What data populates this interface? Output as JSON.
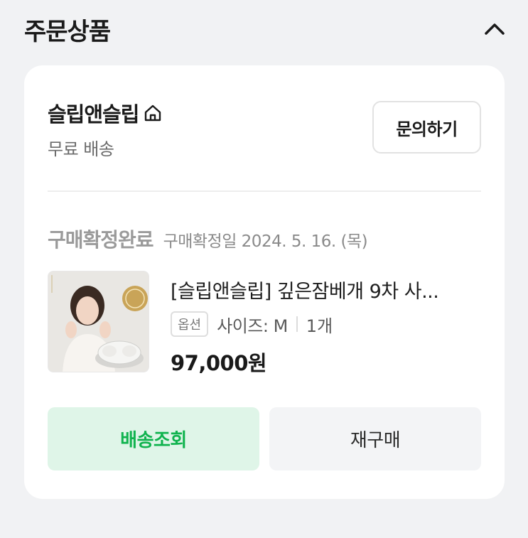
{
  "section": {
    "title": "주문상품",
    "collapse_icon": "chevron-up-icon"
  },
  "order": {
    "seller": {
      "name": "슬립앤슬립",
      "store_icon": "home-icon",
      "shipping": "무료 배송"
    },
    "inquiry_label": "문의하기",
    "status": {
      "label": "구매확정완료",
      "date_text": "구매확정일 2024. 5. 16. (목)"
    },
    "product": {
      "title": "[슬립앤슬립] 깊은잠베개 9차 사...",
      "option_tag": "옵션",
      "option_value": "사이즈: M",
      "quantity": "1개",
      "price": "97,000원"
    },
    "actions": {
      "track_label": "배송조회",
      "rebuy_label": "재구매"
    }
  },
  "colors": {
    "page_bg": "#f1f2f4",
    "card_bg": "#ffffff",
    "accent_green": "#10b34e",
    "accent_green_bg": "#dff5e8"
  }
}
